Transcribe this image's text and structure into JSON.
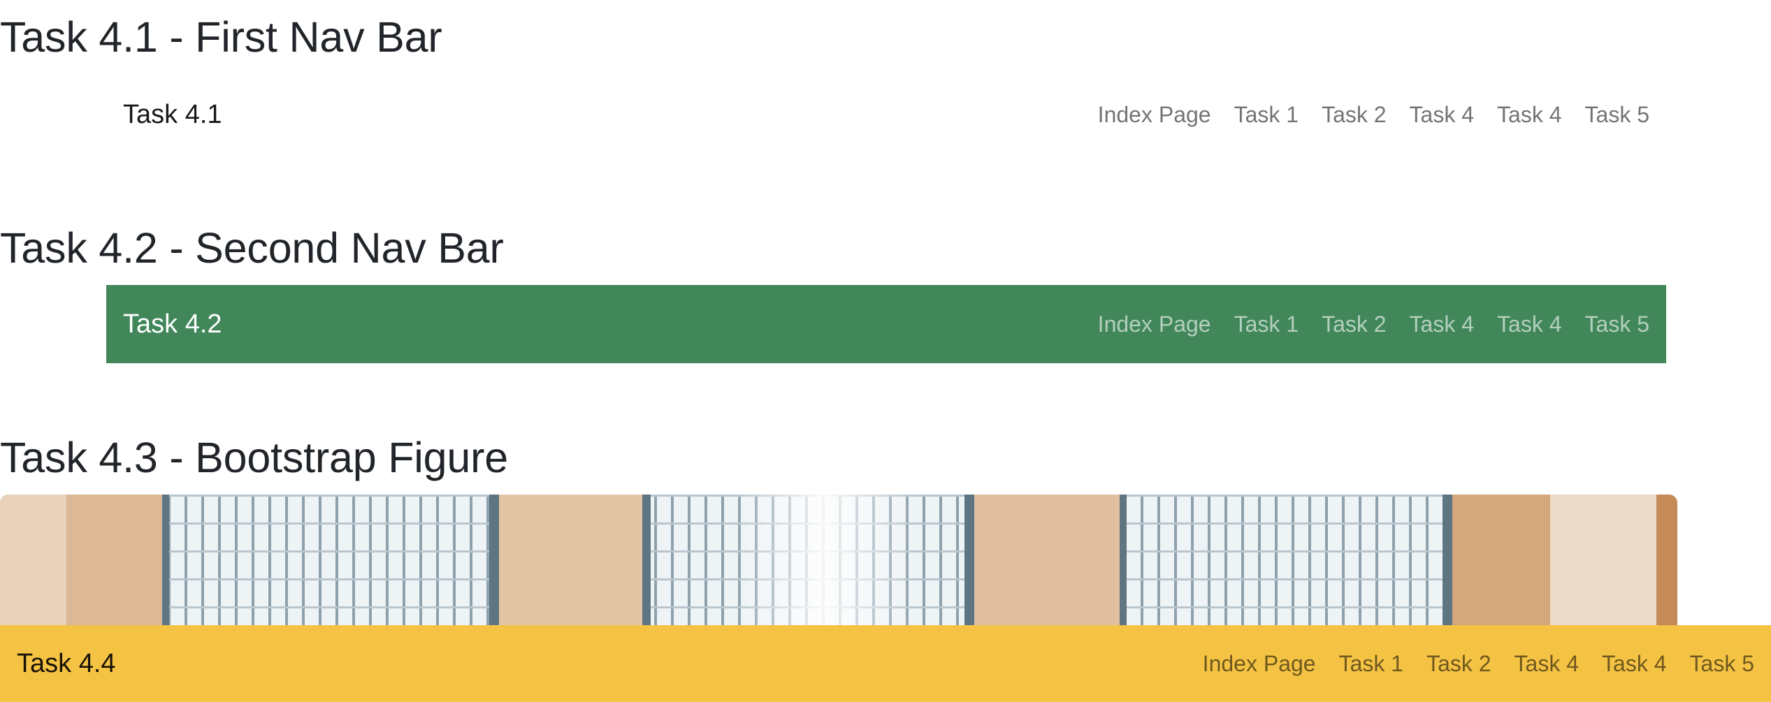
{
  "sections": {
    "task41": {
      "heading": "Task 4.1 - First Nav Bar"
    },
    "task42": {
      "heading": "Task 4.2 - Second Nav Bar"
    },
    "task43": {
      "heading": "Task 4.3 - Bootstrap Figure"
    }
  },
  "nav1": {
    "brand": "Task 4.1",
    "links": [
      "Index Page",
      "Task 1",
      "Task 2",
      "Task 4",
      "Task 4",
      "Task 5"
    ]
  },
  "nav2": {
    "brand": "Task 4.2",
    "background": "#41875a",
    "links": [
      "Index Page",
      "Task 1",
      "Task 2",
      "Task 4",
      "Task 4",
      "Task 5"
    ]
  },
  "nav4": {
    "brand": "Task 4.4",
    "background": "#f5c344",
    "links": [
      "Index Page",
      "Task 1",
      "Task 2",
      "Task 4",
      "Task 4",
      "Task 5"
    ]
  },
  "figure": {
    "icon": "photo-of-skylight-windows"
  }
}
